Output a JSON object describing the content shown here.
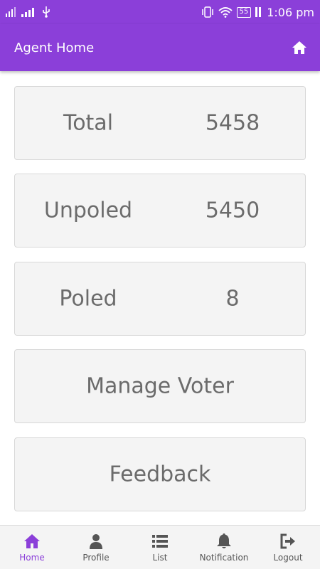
{
  "status_bar": {
    "time": "1:06 pm",
    "battery": "55",
    "icons": [
      "signal-icon",
      "signal-bars-icon",
      "usb-icon",
      "vibrate-icon",
      "wifi-icon",
      "battery-icon"
    ]
  },
  "app_bar": {
    "title": "Agent Home",
    "home_icon": "home-icon"
  },
  "stats": [
    {
      "label": "Total",
      "value": "5458"
    },
    {
      "label": "Unpoled",
      "value": "5450"
    },
    {
      "label": "Poled",
      "value": "8"
    }
  ],
  "actions": [
    {
      "label": "Manage Voter"
    },
    {
      "label": "Feedback"
    }
  ],
  "bottom_nav": [
    {
      "label": "Home",
      "icon": "home-icon",
      "active": true
    },
    {
      "label": "Profile",
      "icon": "user-icon",
      "active": false
    },
    {
      "label": "List",
      "icon": "list-icon",
      "active": false
    },
    {
      "label": "Notification",
      "icon": "bell-icon",
      "active": false
    },
    {
      "label": "Logout",
      "icon": "logout-icon",
      "active": false
    }
  ],
  "colors": {
    "primary": "#8b3fd9",
    "card_bg": "#f4f4f4",
    "card_text": "#6b6b6b",
    "nav_text": "#555555"
  }
}
